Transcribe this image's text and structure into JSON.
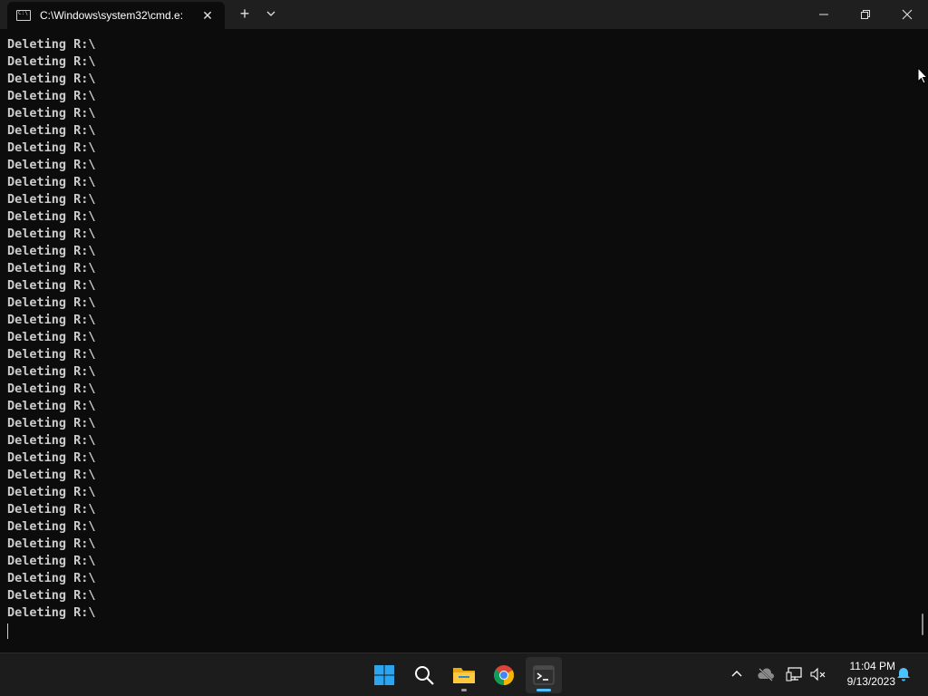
{
  "window": {
    "tab_title": "C:\\Windows\\system32\\cmd.e:",
    "tab_close": "✕",
    "new_tab": "+"
  },
  "terminal": {
    "lines": [
      "Deleting R:\\",
      "Deleting R:\\",
      "Deleting R:\\",
      "Deleting R:\\",
      "Deleting R:\\",
      "Deleting R:\\",
      "Deleting R:\\",
      "Deleting R:\\",
      "Deleting R:\\",
      "Deleting R:\\",
      "Deleting R:\\",
      "Deleting R:\\",
      "Deleting R:\\",
      "Deleting R:\\",
      "Deleting R:\\",
      "Deleting R:\\",
      "Deleting R:\\",
      "Deleting R:\\",
      "Deleting R:\\",
      "Deleting R:\\",
      "Deleting R:\\",
      "Deleting R:\\",
      "Deleting R:\\",
      "Deleting R:\\",
      "Deleting R:\\",
      "Deleting R:\\",
      "Deleting R:\\",
      "Deleting R:\\",
      "Deleting R:\\",
      "Deleting R:\\",
      "Deleting R:\\",
      "Deleting R:\\",
      "Deleting R:\\",
      "Deleting R:\\"
    ]
  },
  "taskbar": {
    "apps": [
      "start-icon",
      "search-icon",
      "file-explorer-icon",
      "chrome-icon",
      "terminal-icon"
    ],
    "tray": [
      "chevron-up-icon",
      "onedrive-offline-icon",
      "network-icon",
      "volume-muted-icon",
      "notification-bell-icon"
    ],
    "clock": {
      "time": "11:04 PM",
      "date": "9/13/2023"
    }
  },
  "colors": {
    "terminal_bg": "#0c0c0c",
    "terminal_text": "#cccccc",
    "titlebar_bg": "#1f1f1f",
    "taskbar_bg": "#1c1c1c",
    "accent": "#4cc2ff"
  }
}
